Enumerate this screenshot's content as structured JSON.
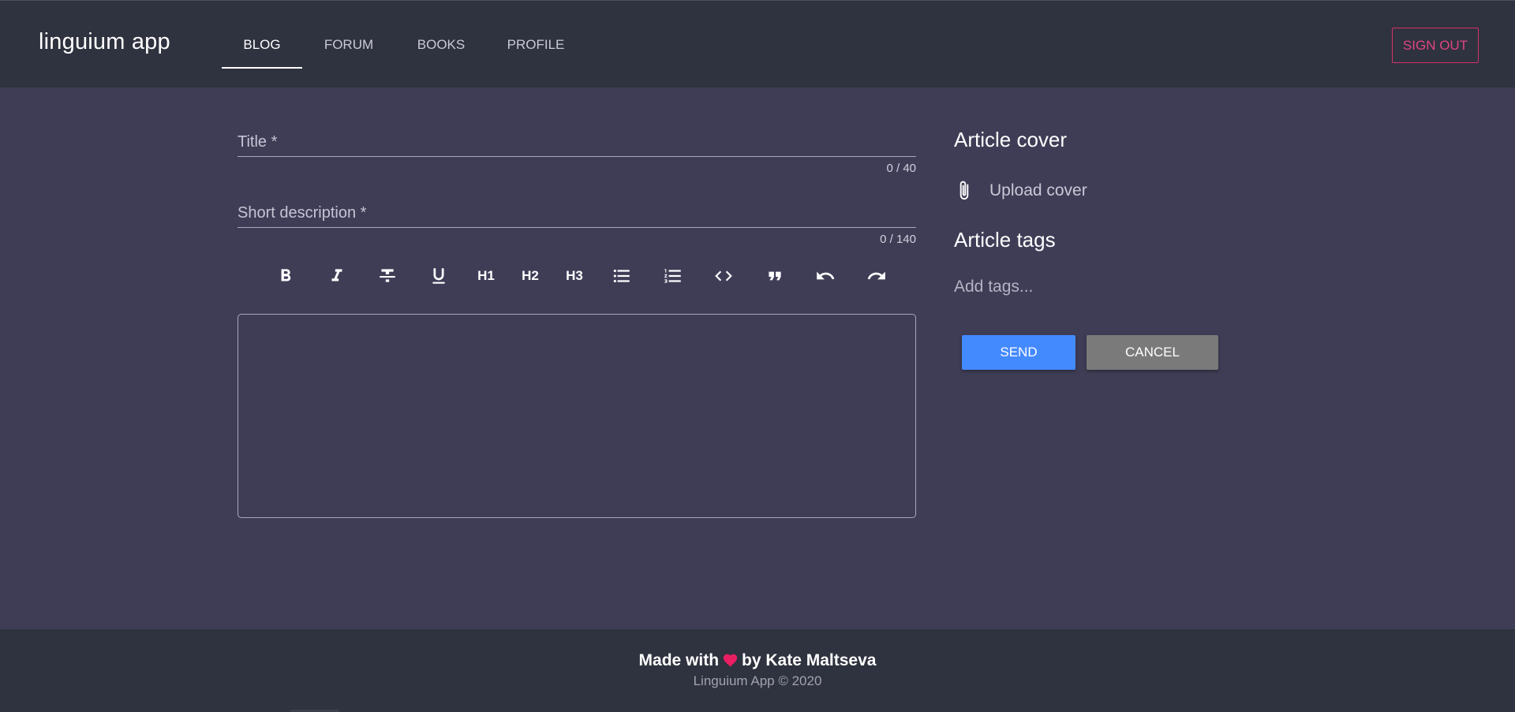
{
  "header": {
    "brand": "linguium app",
    "tabs": [
      {
        "label": "BLOG",
        "active": true
      },
      {
        "label": "FORUM",
        "active": false
      },
      {
        "label": "BOOKS",
        "active": false
      },
      {
        "label": "PROFILE",
        "active": false
      }
    ],
    "sign_out_label": "SIGN OUT"
  },
  "form": {
    "title": {
      "label": "Title *",
      "counter": "0 / 40",
      "value": ""
    },
    "description": {
      "label": "Short description *",
      "counter": "0 / 140",
      "value": ""
    },
    "toolbar": [
      {
        "name": "bold-icon"
      },
      {
        "name": "italic-icon"
      },
      {
        "name": "strikethrough-icon"
      },
      {
        "name": "underline-icon"
      },
      {
        "label": "H1"
      },
      {
        "label": "H2"
      },
      {
        "label": "H3"
      },
      {
        "name": "bullet-list-icon"
      },
      {
        "name": "ordered-list-icon"
      },
      {
        "name": "code-icon"
      },
      {
        "name": "quote-icon"
      },
      {
        "name": "undo-icon"
      },
      {
        "name": "redo-icon"
      }
    ],
    "editor_content": ""
  },
  "sidebar": {
    "cover_title": "Article cover",
    "upload_label": "Upload cover",
    "upload_icon": "paperclip-icon",
    "tags_title": "Article tags",
    "tags_placeholder": "Add tags...",
    "send_label": "SEND",
    "cancel_label": "CANCEL"
  },
  "footer": {
    "made_prefix": "Made with",
    "made_suffix": "by Kate Maltseva",
    "copyright": "Linguium App © 2020"
  },
  "colors": {
    "header_bg": "#2f323f",
    "page_bg": "#3f3d56",
    "accent_signout": "#e0457f",
    "send_button": "#448aff",
    "cancel_button": "#7a7a7a",
    "heart": "#e91e63"
  }
}
